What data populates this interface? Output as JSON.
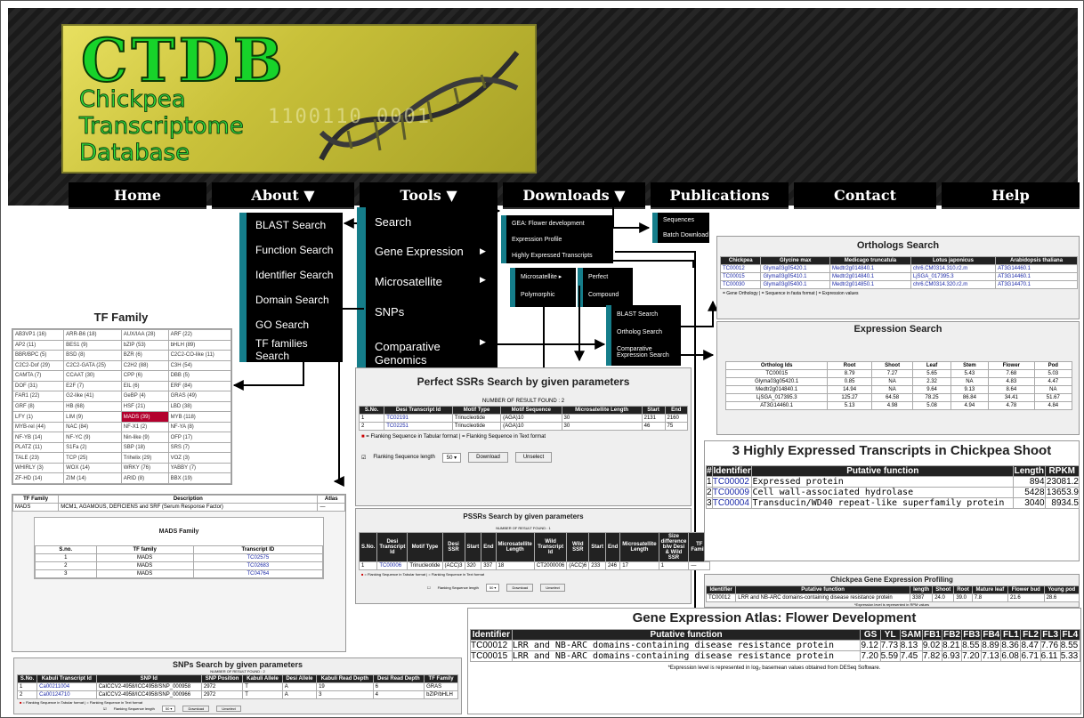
{
  "logo": {
    "title": "CTDB",
    "line1": "Chickpea",
    "line2": "Transcriptome",
    "line3": "Database",
    "binary": "1100110 0001"
  },
  "nav": [
    "Home",
    "About ▼",
    "Tools ▼",
    "Downloads ▼",
    "Publications",
    "Contact",
    "Help"
  ],
  "about_menu": [
    "BLAST Search",
    "Function Search",
    "Identifier Search",
    "Domain Search",
    "GO Search",
    "TF families Search"
  ],
  "tools_menu": [
    "Search",
    "Gene Expression",
    "Microsatellite",
    "SNPs",
    "Comparative Genomics"
  ],
  "gene_expression_menu": [
    "GEA: Flower development",
    "Expression Profile",
    "Highly Expressed Transcripts"
  ],
  "microsatellite_menu": [
    "Microsatellite ▸",
    "Polymorphic"
  ],
  "ssr_menu": [
    "Perfect",
    "Compound"
  ],
  "comparative_menu": [
    "BLAST Search",
    "Ortholog Search",
    "Comparative Expression Search"
  ],
  "downloads_menu": [
    "Sequences",
    "Batch Download"
  ],
  "tf_family": {
    "heading": "TF Family",
    "grid": [
      [
        "AB3VP1 (16)",
        "ARR-B6 (18)",
        "AUX/IAA (28)",
        "ARF (22)"
      ],
      [
        "AP2 (11)",
        "BES1 (9)",
        "bZIP (53)",
        "bHLH (89)"
      ],
      [
        "BBR/BPC (5)",
        "BSD (8)",
        "BZR (6)",
        "C2C2-CO-like (11)"
      ],
      [
        "C2C2-Dof (29)",
        "C2C2-GATA (25)",
        "C2H2 (88)",
        "C3H (54)"
      ],
      [
        "CAMTA (7)",
        "CCAAT (30)",
        "CPP (6)",
        "DBB (5)"
      ],
      [
        "DOF (31)",
        "E2F (7)",
        "EIL (6)",
        "ERF (84)"
      ],
      [
        "FAR1 (22)",
        "G2-like (41)",
        "GeBP (4)",
        "GRAS (49)"
      ],
      [
        "GRF (8)",
        "HB (68)",
        "HSF (21)",
        "LBD (38)"
      ],
      [
        "LFY (1)",
        "LIM (9)",
        "MADS (39)",
        "MYB (118)"
      ],
      [
        "MYB-rel (44)",
        "NAC (84)",
        "NF-X1 (2)",
        "NF-YA (8)"
      ],
      [
        "NF-YB (14)",
        "NF-YC (9)",
        "Nin-like (9)",
        "OFP (17)"
      ],
      [
        "PLATZ (11)",
        "S1Fa (2)",
        "SBP (18)",
        "SRS (7)"
      ],
      [
        "TALE (23)",
        "TCP (25)",
        "Trihelix (29)",
        "VOZ (3)"
      ],
      [
        "WHIRLY (3)",
        "WOX (14)",
        "WRKY (76)",
        "YABBY (7)"
      ],
      [
        "ZF-HD (14)",
        "ZIM (14)",
        "ARID (8)",
        "BBX (19)"
      ]
    ],
    "highlight": "MADS (39)"
  },
  "tf_desc": {
    "headers": [
      "TF Family",
      "Description",
      "Atlas"
    ],
    "row": [
      "MADS",
      "MCM1, AGAMOUS, DEFICIENS and SRF (Serum Response Factor)",
      "—"
    ],
    "subtitle": "MADS Family",
    "sub_headers": [
      "S.no.",
      "TF family",
      "Transcript ID"
    ],
    "rows": [
      [
        "1",
        "MADS",
        "TC02575"
      ],
      [
        "2",
        "MADS",
        "TC02683"
      ],
      [
        "3",
        "MADS",
        "TC04764"
      ]
    ]
  },
  "perfect_ssr": {
    "title": "Perfect SSRs Search by given parameters",
    "count": "NUMBER OF RESULT FOUND : 2",
    "headers": [
      "S.No.",
      "Desi Transcript Id",
      "Motif Type",
      "Motif Sequence",
      "Microsatellite Length",
      "Start",
      "End"
    ],
    "rows": [
      [
        "1",
        "TC02191",
        "Trinucleotide",
        "(AGA)10",
        "30",
        "2131",
        "2160"
      ],
      [
        "2",
        "TC02251",
        "Trinucleotide",
        "(AGA)10",
        "30",
        "46",
        "75"
      ]
    ],
    "legend": "= Flanking Sequence in Tabular format | = Flanking Sequence in Text format",
    "flank_label": "Flanking Sequence length",
    "flank_value": "50 ▾",
    "download": "Download",
    "unselect": "Unselect"
  },
  "pssr": {
    "title": "PSSRs Search by given parameters",
    "count": "NUMBER OF RESULT FOUND : 1",
    "headers": [
      "S.No.",
      "Desi Transcript Id",
      "Motif Type",
      "Desi SSR",
      "Start",
      "End",
      "Microsatellite Length",
      "Wild Transcript Id",
      "Wild SSR",
      "Start",
      "End",
      "Microsatellite Length",
      "Size difference b/w Desi & Wild SSR",
      "TF Family"
    ],
    "row": [
      "1",
      "TC00006",
      "Trinucleotide",
      "(ACC)3",
      "320",
      "337",
      "18",
      "CT2000006",
      "(ACC)6",
      "233",
      "246",
      "17",
      "1",
      "—"
    ],
    "legend": "= Flanking Sequence in Tabular format | = Flanking Sequence in Text format",
    "flank_label": "Flanking Sequence length",
    "flank_value": "50 ▾",
    "download": "Download",
    "unselect": "Unselect"
  },
  "snps": {
    "title": "SNPs Search by given parameters",
    "count": "NUMBER OF RESULT FOUND : 2",
    "headers": [
      "S.No.",
      "Kabuli Transcript Id",
      "SNP Id",
      "SNP Position",
      "Kabuli Allele",
      "Desi Allele",
      "Kabuli Read Depth",
      "Desi Read Depth",
      "TF Family"
    ],
    "rows": [
      [
        "1",
        "Ca00211004",
        "CaICCV2-4958/ICC4958/SNP_000958",
        "2972",
        "T",
        "A",
        "19",
        "6",
        "GRAS"
      ],
      [
        "2",
        "Ca00124710",
        "CaICCV2-4958/ICC4958/SNP_000966",
        "2972",
        "T",
        "A",
        "3",
        "4",
        "bZIP/bHLH"
      ]
    ],
    "legend": "= Flanking Sequence in Tabular format | = Flanking Sequence in Text format",
    "flank_label": "Flanking Sequence length",
    "flank_value": "50 ▾",
    "download": "Download",
    "unselect": "Unselect"
  },
  "orthologs": {
    "title": "Orthologs Search",
    "headers": [
      "Chickpea",
      "Glycine max",
      "Medicago truncatula",
      "Lotus japonicus",
      "Arabidopsis thaliana"
    ],
    "rows": [
      [
        "TC00012",
        "Glyma03g05420.1",
        "Medtr2g014840.1",
        "chr6.CM0314.310.r2.m",
        "AT3G14460.1"
      ],
      [
        "TC00015",
        "Glyma03g05410.1",
        "Medtr2g014840.1",
        "LjSGA_017395.3",
        "AT3G14460.1"
      ],
      [
        "TC00030",
        "Glyma03g05400.1",
        "Medtr2g014850.1",
        "chr6.CM0314.320.r2.m",
        "AT3G14470.1"
      ]
    ],
    "legend": "= Gene Orthology | = Sequence in fasta format | = Expression values"
  },
  "expression_search": {
    "title": "Expression Search",
    "headers": [
      "Ortholog Ids",
      "Root",
      "Shoot",
      "Leaf",
      "Stem",
      "Flower",
      "Pod"
    ],
    "rows": [
      [
        "TC00015",
        "8.79",
        "7.27",
        "5.65",
        "5.43",
        "7.68",
        "5.03"
      ],
      [
        "Glyma03g05420.1",
        "0.85",
        "NA",
        "2.32",
        "NA",
        "4.83",
        "4.47"
      ],
      [
        "Medtr2g014840.1",
        "14.94",
        "NA",
        "9.64",
        "9.13",
        "8.64",
        "NA"
      ],
      [
        "LjSGA_017395.3",
        "125.27",
        "64.58",
        "78.25",
        "86.84",
        "34.41",
        "51.67"
      ],
      [
        "AT3G14460.1",
        "5.13",
        "4.98",
        "5.08",
        "4.94",
        "4.78",
        "4.84"
      ]
    ]
  },
  "highly_expressed": {
    "title": "3 Highly Expressed Transcripts in Chickpea Shoot",
    "headers": [
      "#",
      "Identifier",
      "Putative function",
      "Length",
      "RPKM"
    ],
    "rows": [
      [
        "1",
        "TC00002",
        "Expressed protein",
        "894",
        "23081.2"
      ],
      [
        "2",
        "TC00009",
        "Cell wall-associated hydrolase",
        "5428",
        "13653.9"
      ],
      [
        "3",
        "TC00004",
        "Transducin/WD40 repeat-like superfamily protein",
        "3040",
        "8934.5"
      ]
    ]
  },
  "gene_profiling": {
    "title": "Chickpea Gene Expression Profiling",
    "headers": [
      "Identifier",
      "Putative function",
      "length",
      "Shoot",
      "Root",
      "Mature leaf",
      "Flower bud",
      "Young pod"
    ],
    "row": [
      "TC00012",
      "LRR and NB-ARC domains-containing disease resistance protein",
      "3387",
      "24.0",
      "39.0",
      "7.8",
      "21.6",
      "28.6"
    ],
    "note": "*Expression level is represented in RPM values"
  },
  "atlas": {
    "title": "Gene Expression Atlas: Flower Development",
    "headers": [
      "Identifier",
      "Putative function",
      "GS",
      "YL",
      "SAM",
      "FB1",
      "FB2",
      "FB3",
      "FB4",
      "FL1",
      "FL2",
      "FL3",
      "FL4"
    ],
    "rows": [
      [
        "TC00012",
        "LRR and NB-ARC domains-containing disease resistance protein",
        "9.12",
        "7.73",
        "8.13",
        "9.02",
        "8.21",
        "8.55",
        "8.89",
        "8.36",
        "8.47",
        "7.76",
        "8.55"
      ],
      [
        "TC00015",
        "LRR and NB-ARC domains-containing disease resistance protein",
        "7.20",
        "5.59",
        "7.45",
        "7.82",
        "6.93",
        "7.20",
        "7.13",
        "6.08",
        "6.71",
        "6.11",
        "5.33"
      ]
    ],
    "note": "*Expression level is represented in log₂ basemean values obtained from DESeq Software."
  },
  "colors": {
    "menu_accent": "#157d8a",
    "nav_bg": "#000000",
    "highlight": "#b3002d",
    "logo_green": "#17d32a"
  }
}
